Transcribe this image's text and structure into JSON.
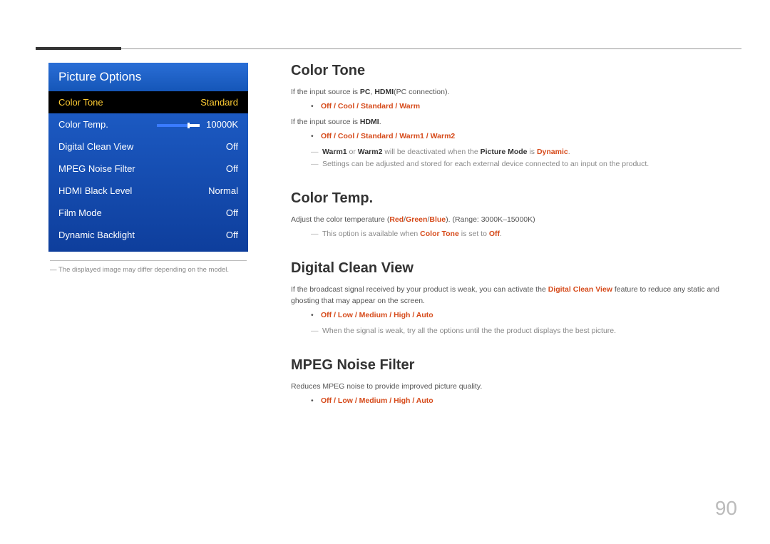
{
  "page_number": "90",
  "osd": {
    "title": "Picture Options",
    "rows": [
      {
        "label": "Color Tone",
        "value": "Standard",
        "selected": true
      },
      {
        "label": "Color Temp.",
        "value": "10000K",
        "slider": true
      },
      {
        "label": "Digital Clean View",
        "value": "Off"
      },
      {
        "label": "MPEG Noise Filter",
        "value": "Off"
      },
      {
        "label": "HDMI Black Level",
        "value": "Normal"
      },
      {
        "label": "Film Mode",
        "value": "Off"
      },
      {
        "label": "Dynamic Backlight",
        "value": "Off"
      }
    ],
    "footnote_prefix": "―",
    "footnote": "The displayed image may differ depending on the model."
  },
  "sections": {
    "color_tone": {
      "heading": "Color Tone",
      "line1_pre": "If the input source is ",
      "line1_b1": "PC",
      "line1_mid": ", ",
      "line1_b2": "HDMI",
      "line1_post": "(PC connection).",
      "opts1": "Off / Cool / Standard / Warm",
      "line2_pre": "If the input source is ",
      "line2_b": "HDMI",
      "line2_post": ".",
      "opts2": "Off / Cool / Standard / Warm1 / Warm2",
      "note1_a": "Warm1",
      "note1_mid": " or ",
      "note1_b": "Warm2",
      "note1_rest": " will be deactivated when the ",
      "note1_pm": "Picture Mode",
      "note1_is": " is ",
      "note1_dyn": "Dynamic",
      "note1_dot": ".",
      "note2": "Settings can be adjusted and stored for each external device connected to an input on the product."
    },
    "color_temp": {
      "heading": "Color Temp.",
      "line_pre": "Adjust the color temperature (",
      "r": "Red",
      "sep": "/",
      "g": "Green",
      "b": "Blue",
      "line_post": "). (Range: 3000K–15000K)",
      "note_pre": "This option is available when ",
      "note_ct": "Color Tone",
      "note_mid": " is set to ",
      "note_off": "Off",
      "note_dot": "."
    },
    "dcv": {
      "heading": "Digital Clean View",
      "para_pre": "If the broadcast signal received by your product is weak, you can activate the ",
      "para_hl": "Digital Clean View",
      "para_post": " feature to reduce any static and ghosting that may appear on the screen.",
      "opts": "Off / Low / Medium / High / Auto",
      "note": "When the signal is weak, try all the options until the the product displays the best picture."
    },
    "mpeg": {
      "heading": "MPEG Noise Filter",
      "para": "Reduces MPEG noise to provide improved picture quality.",
      "opts": "Off / Low / Medium / High / Auto"
    }
  }
}
